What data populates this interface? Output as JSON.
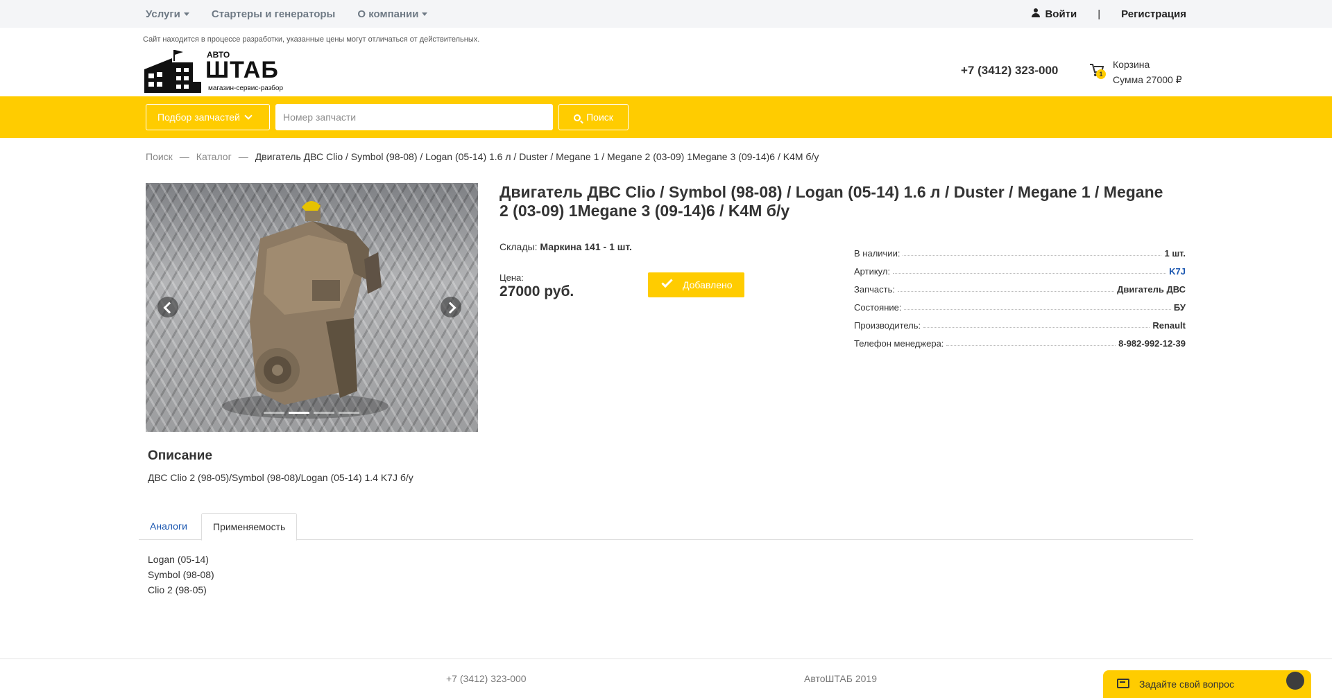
{
  "topnav": {
    "services": "Услуги",
    "starters": "Стартеры и генераторы",
    "about": "О компании",
    "login": "Войти",
    "separator": "|",
    "register": "Регистрация"
  },
  "header": {
    "notice": "Сайт находится в процессе разработки, указанные цены могут отличаться от действительных.",
    "logo": {
      "small": "АВТО",
      "big": "ШТАБ",
      "tagline": "магазин-сервис-разбор"
    },
    "phone": "+7 (3412) 323-000",
    "cart": {
      "label": "Корзина",
      "sum": "Сумма 27000 ₽",
      "count": "1"
    }
  },
  "search": {
    "select_label": "Подбор запчастей",
    "placeholder": "Номер запчасти",
    "button": "Поиск"
  },
  "breadcrumb": {
    "items": [
      "Поиск",
      "Каталог"
    ],
    "separator": "—",
    "current": "Двигатель ДВС Clio / Symbol (98-08) / Logan (05-14) 1.6 л / Duster / Megane 1 / Megane 2 (03-09) 1Megane 3 (09-14)6 / K4M б/у"
  },
  "product": {
    "title": "Двигатель ДВС Clio / Symbol (98-08) / Logan (05-14) 1.6 л / Duster / Megane 1 / Megane 2 (03-09) 1Megane 3 (09-14)6 / K4M б/у",
    "stock_label": "Склады:",
    "stock_value": "Маркина 141 - 1 шт.",
    "price_label": "Цена:",
    "price": "27000 руб.",
    "added_button": "Добавлено",
    "gallery": {
      "slides": 4,
      "active": 2
    },
    "specs": [
      {
        "label": "В наличии:",
        "value": "1 шт."
      },
      {
        "label": "Артикул:",
        "value": "K7J"
      },
      {
        "label": "Запчасть:",
        "value": "Двигатель ДВС"
      },
      {
        "label": "Состояние:",
        "value": "БУ"
      },
      {
        "label": "Производитель:",
        "value": "Renault"
      },
      {
        "label": "Телефон менеджера:",
        "value": "8-982-992-12-39"
      }
    ]
  },
  "description": {
    "heading": "Описание",
    "text": "ДВС Clio 2 (98-05)/Symbol (98-08)/Logan (05-14) 1.4 K7J б/у"
  },
  "tabs": {
    "analogs": "Аналоги",
    "applicability": "Применяемость",
    "applicability_items": [
      "Logan (05-14)",
      "Symbol (98-08)",
      "Clio 2 (98-05)"
    ]
  },
  "footer": {
    "phone": "+7 (3412) 323-000",
    "copyright": "АвтоШТАБ 2019",
    "ask": "Задайте свой вопрос"
  },
  "colors": {
    "accent": "#ffcc00",
    "link": "#1a56b0"
  }
}
